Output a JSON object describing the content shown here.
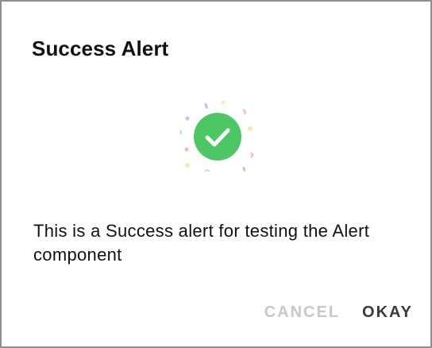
{
  "dialog": {
    "title": "Success Alert",
    "message": "This is a Success alert for testing the Alert component",
    "icon": "success-check-icon",
    "accent_color": "#4cc764",
    "buttons": {
      "cancel_label": "CANCEL",
      "okay_label": "OKAY"
    }
  }
}
